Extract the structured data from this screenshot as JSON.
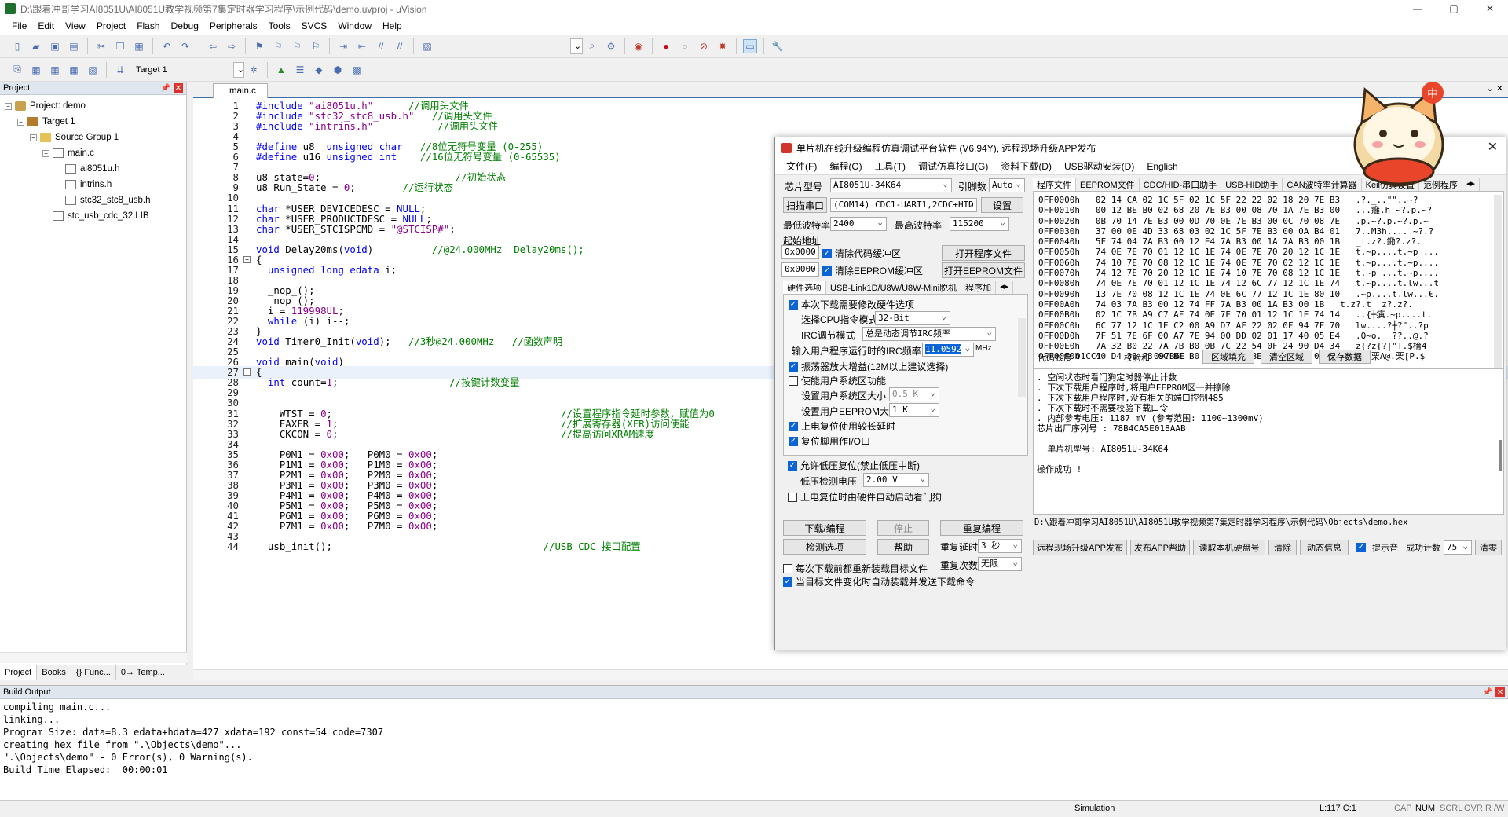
{
  "window": {
    "title": "D:\\跟着冲哥学习AI8051U\\AI8051U教学视频第7集定时器学习程序\\示例代码\\demo.uvproj - µVision",
    "controls": [
      "—",
      "▢",
      "✕"
    ]
  },
  "menu": [
    "File",
    "Edit",
    "View",
    "Project",
    "Flash",
    "Debug",
    "Peripherals",
    "Tools",
    "SVCS",
    "Window",
    "Help"
  ],
  "toolbar2": {
    "target": "Target 1"
  },
  "project": {
    "header": "Project",
    "tree": [
      {
        "label": "Project: demo",
        "level": 0,
        "type": "proj",
        "exp": "−"
      },
      {
        "label": "Target 1",
        "level": 1,
        "type": "target",
        "exp": "−"
      },
      {
        "label": "Source Group 1",
        "level": 2,
        "type": "folder",
        "exp": "−"
      },
      {
        "label": "main.c",
        "level": 3,
        "type": "file",
        "exp": "−"
      },
      {
        "label": "ai8051u.h",
        "level": 4,
        "type": "file",
        "exp": ""
      },
      {
        "label": "intrins.h",
        "level": 4,
        "type": "file",
        "exp": ""
      },
      {
        "label": "stc32_stc8_usb.h",
        "level": 4,
        "type": "file",
        "exp": ""
      },
      {
        "label": "stc_usb_cdc_32.LIB",
        "level": 3,
        "type": "file",
        "exp": ""
      }
    ],
    "tabs": [
      "Project",
      "Books",
      "{} Func...",
      "0→ Temp..."
    ]
  },
  "editor": {
    "tab": "main.c",
    "lines": [
      {
        "n": "1",
        "code": "#include \"ai8051u.h\"      //调用头文件"
      },
      {
        "n": "2",
        "code": "#include \"stc32_stc8_usb.h\"   //调用头文件"
      },
      {
        "n": "3",
        "code": "#include \"intrins.h\"           //调用头文件"
      },
      {
        "n": "4",
        "code": ""
      },
      {
        "n": "5",
        "code": "#define u8  unsigned char   //8位无符号变量 (0-255)"
      },
      {
        "n": "6",
        "code": "#define u16 unsigned int    //16位无符号变量 (0-65535)"
      },
      {
        "n": "7",
        "code": ""
      },
      {
        "n": "8",
        "code": "u8 state=0;                       //初始状态"
      },
      {
        "n": "9",
        "code": "u8 Run_State = 0;        //运行状态"
      },
      {
        "n": "10",
        "code": ""
      },
      {
        "n": "11",
        "code": "char *USER_DEVICEDESC = NULL;"
      },
      {
        "n": "12",
        "code": "char *USER_PRODUCTDESC = NULL;"
      },
      {
        "n": "13",
        "code": "char *USER_STCISPCMD = \"@STCISP#\";"
      },
      {
        "n": "14",
        "code": ""
      },
      {
        "n": "15",
        "code": "void Delay20ms(void)          //@24.000MHz  Delay20ms();"
      },
      {
        "n": "16",
        "code": "{"
      },
      {
        "n": "17",
        "code": "  unsigned long edata i;"
      },
      {
        "n": "18",
        "code": ""
      },
      {
        "n": "19",
        "code": "  _nop_();"
      },
      {
        "n": "20",
        "code": "  _nop_();"
      },
      {
        "n": "21",
        "code": "  i = 119998UL;"
      },
      {
        "n": "22",
        "code": "  while (i) i--;"
      },
      {
        "n": "23",
        "code": "}"
      },
      {
        "n": "24",
        "code": "void Timer0_Init(void);   //3秒@24.000MHz   //函数声明"
      },
      {
        "n": "25",
        "code": ""
      },
      {
        "n": "26",
        "code": "void main(void)"
      },
      {
        "n": "27",
        "code": "{"
      },
      {
        "n": "28",
        "code": "  int count=1;                   //按键计数变量"
      },
      {
        "n": "29",
        "code": ""
      },
      {
        "n": "30",
        "code": ""
      },
      {
        "n": "31",
        "code": "    WTST = 0;                                       //设置程序指令延时参数，赋值为0"
      },
      {
        "n": "32",
        "code": "    EAXFR = 1;                                      //扩展寄存器(XFR)访问使能"
      },
      {
        "n": "33",
        "code": "    CKCON = 0;                                      //提高访问XRAM速度"
      },
      {
        "n": "34",
        "code": ""
      },
      {
        "n": "35",
        "code": "    P0M1 = 0x00;   P0M0 = 0x00;"
      },
      {
        "n": "36",
        "code": "    P1M1 = 0x00;   P1M0 = 0x00;"
      },
      {
        "n": "37",
        "code": "    P2M1 = 0x00;   P2M0 = 0x00;"
      },
      {
        "n": "38",
        "code": "    P3M1 = 0x00;   P3M0 = 0x00;"
      },
      {
        "n": "39",
        "code": "    P4M1 = 0x00;   P4M0 = 0x00;"
      },
      {
        "n": "40",
        "code": "    P5M1 = 0x00;   P5M0 = 0x00;"
      },
      {
        "n": "41",
        "code": "    P6M1 = 0x00;   P6M0 = 0x00;"
      },
      {
        "n": "42",
        "code": "    P7M1 = 0x00;   P7M0 = 0x00;"
      },
      {
        "n": "43",
        "code": ""
      },
      {
        "n": "44",
        "code": "  usb_init();                                    //USB CDC 接口配置"
      }
    ]
  },
  "build": {
    "header": "Build Output",
    "lines": [
      "compiling main.c...",
      "linking...",
      "Program Size: data=8.3 edata+hdata=427 xdata=192 const=54 code=7307",
      "creating hex file from \".\\Objects\\demo\"...",
      "\".\\Objects\\demo\" - 0 Error(s), 0 Warning(s).",
      "Build Time Elapsed:  00:00:01"
    ]
  },
  "status": {
    "mode": "Simulation",
    "pos": "L:117 C:1",
    "caps": "CAP",
    "num": "NUM",
    "scrl": "SCRL",
    "ovr": "OVR",
    "rw": "R /W"
  },
  "isp": {
    "title": "单片机在线升级编程仿真调试平台软件 (V6.94Y), 远程现场升级APP发布",
    "menu": [
      "文件(F)",
      "编程(O)",
      "工具(T)",
      "调试仿真接口(G)",
      "资料下载(D)",
      "USB驱动安装(D)",
      "English"
    ],
    "chip_label": "芯片型号",
    "chip_value": "AI8051U-34K64",
    "pin_label": "引脚数",
    "pin_value": "Auto",
    "port_btn": "扫描串口",
    "port_value": "(COM14) CDC1-UART1,2CDC+HID",
    "settings_btn": "设置",
    "min_baud_label": "最低波特率",
    "min_baud": "2400",
    "max_baud_label": "最高波特率",
    "max_baud": "115200",
    "start_addr_label": "起始地址",
    "addr1": "0x0000",
    "clear_code": "清除代码缓冲区",
    "open_prog": "打开程序文件",
    "addr2": "0x0000",
    "clear_eeprom": "清除EEPROM缓冲区",
    "open_eeprom": "打开EEPROM文件",
    "hw_tabs": [
      "硬件选项",
      "USB-Link1D/U8W/U8W-Mini脱机",
      "程序加"
    ],
    "opts": {
      "modify_hw": "本次下载需要修改硬件选项",
      "cpu_mode_label": "选择CPU指令模式",
      "cpu_mode": "32-Bit",
      "irc_mode_label": "IRC调节模式",
      "irc_mode": "总是动态调节IRC频率",
      "irc_freq_label": "输入用户程序运行时的IRC频率",
      "irc_freq": "11.0592",
      "irc_unit": "MHz",
      "osc_gain": "振荡器放大增益(12M以上建议选择)",
      "user_sys": "使能用户系统区功能",
      "sys_size_label": "设置用户系统区大小",
      "sys_size": "0.5 K",
      "eeprom_size_label": "设置用户EEPROM大小",
      "eeprom_size": "1  K",
      "long_reset": "上电复位使用较长延时",
      "reset_io": "复位脚用作I/O口",
      "low_volt_reset": "允许低压复位(禁止低压中断)",
      "low_volt_label": "低压检测电压",
      "low_volt": "2.00 V",
      "watchdog": "上电复位时由硬件自动启动看门狗"
    },
    "btn_download": "下载/编程",
    "btn_stop": "停止",
    "btn_reprog": "重复编程",
    "btn_check": "检测选项",
    "btn_help": "帮助",
    "repeat_delay_label": "重复延时",
    "repeat_delay": "3 秒",
    "repeat_count_label": "重复次数",
    "repeat_count": "无限",
    "reload_each": "每次下载前都重新装载目标文件",
    "auto_send": "当目标文件变化时自动装载并发送下载命令",
    "right_tabs": [
      "程序文件",
      "EEPROM文件",
      "CDC/HID-串口助手",
      "USB-HID助手",
      "CAN波特率计算器",
      "Keil仿真设置",
      "范例程序"
    ],
    "hex_rows": [
      "0FF0000h   02 14 CA 02 1C 5F 02 1C 5F 22 22 02 18 20 7E B3   .?._..\"\"..~?",
      "0FF0010h   00 12 BE B0 02 68 20 7E B3 00 08 70 1A 7E B3 00   ...癰.h ~?.p.~?",
      "0FF0020h   0B 70 14 7E B3 00 0D 70 0E 7E B3 00 0C 70 08 7E   .p.~?.p.~?.p.~",
      "0FF0030h   37 00 0E 4D 33 68 03 02 1C 5F 7E B3 00 0A B4 01   7..M3h...._~?.?",
      "0FF0040h   5F 74 04 7A B3 00 12 E4 7A B3 00 1A 7A B3 00 1B   _t.z?.鋤?.z?.",
      "0FF0050h   74 0E 7E 70 01 12 1C 1E 74 0E 7E 70 20 12 1C 1E   t.~p....t.~p ...",
      "0FF0060h   74 10 7E 70 08 12 1C 1E 74 0E 7E 70 02 12 1C 1E   t.~p....t.~p....",
      "0FF0070h   74 12 7E 70 20 12 1C 1E 74 10 7E 70 08 12 1C 1E   t.~p ...t.~p....",
      "0FF0080h   74 0E 7E 70 01 12 1C 1E 74 12 6C 77 12 1C 1E 74   t.~p....t.lw...t",
      "0FF0090h   13 7E 70 08 12 1C 1E 74 0E 6C 77 12 1C 1E 80 10   .~p....t.lw...€.",
      "0FF00A0h   74 03 7A B3 00 12 74 FF 7A B3 00 1A B3 00 1B   t.z?.t  z?.z?.",
      "0FF00B0h   02 1C 7B A9 C7 AF 74 0E 7E 70 01 12 1C 1E 74 14   ..{┼痶.~p....t.",
      "0FF00C0h   6C 77 12 1C 1E C2 00 A9 D7 AF 22 02 0F 94 7F 70   lw....?┼?\"..?p",
      "0FF00D0h   7F 51 7E 6F 00 A7 7E 94 00 DD 02 01 17 40 05 E4   .Q~o.  ??..@.?",
      "0FF00E0h   7A 32 B0 22 7A 7B B0 0B 7C 22 54 0F 24 90 D4 34   z{?z{?|\"T.$棛4",
      "0FF00F0h   40 D4 30 F3 0C BE B0 41 40 07 BE B0 5B 50 02 24   @??栗A@.栗[P.$"
    ],
    "code_len_label": "代码长度",
    "code_len": "01CC1",
    "checksum_label": "校验和",
    "checksum": "097B6E",
    "btn_fill": "区域填充",
    "btn_clear": "清空区域",
    "btn_save": "保存数据",
    "log_lines": [
      ". 空闲状态时看门狗定时器停止计数",
      ". 下次下载用户程序时,将用户EEPROM区一并擦除",
      ". 下次下载用户程序时,没有相关的端口控制485",
      ". 下次下载时不需要校验下载口令",
      ". 内部参考电压: 1187 mV (参考范围: 1100~1300mV)",
      "芯片出厂序列号 : 78B4CA5E018AAB",
      "",
      "  单片机型号: AI8051U-34K64",
      "",
      "操作成功 !"
    ],
    "hex_path": "D:\\跟着冲哥学习AI8051U\\AI8051U教学视频第7集定时器学习程序\\示例代码\\Objects\\demo.hex",
    "bottom_btns": [
      "远程现场升级APP发布",
      "发布APP帮助",
      "读取本机硬盘号",
      "清除",
      "动态信息"
    ],
    "prompt_sound": "提示音",
    "success_label": "成功计数",
    "success_count": "75",
    "btn_clear2": "清零"
  }
}
